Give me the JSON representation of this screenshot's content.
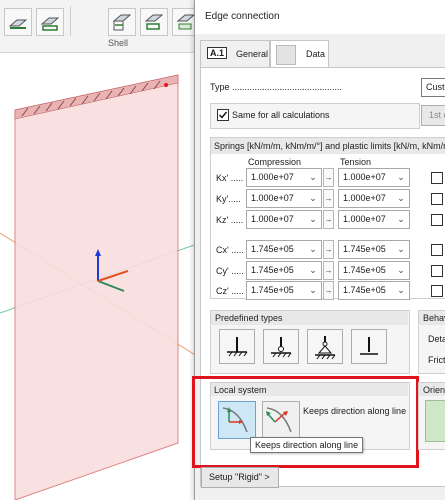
{
  "ribbon": {
    "group_label": "Shell"
  },
  "dialog": {
    "title": "Edge connection",
    "tabs": [
      {
        "icon_text": "A.1",
        "label": "General"
      },
      {
        "label": "Data"
      }
    ],
    "type_label": "Type ............................................",
    "type_value": "Custo",
    "same_for_all_label": "Same for all calculations",
    "same_for_all_checked": true,
    "first_order_button": "1st o",
    "springs_title": "Springs [kN/m/m, kNm/m/°] and plastic limits [kN/m, kNm/m]",
    "compression_header": "Compression",
    "tension_header": "Tension",
    "rows": [
      {
        "label": "Kx' .....",
        "compression": "1.000e+07",
        "tension": "1.000e+07"
      },
      {
        "label": "Ky'.....",
        "compression": "1.000e+07",
        "tension": "1.000e+07"
      },
      {
        "label": "Kz' .....",
        "compression": "1.000e+07",
        "tension": "1.000e+07"
      },
      {
        "label": "Cx' .....",
        "compression": "1.745e+05",
        "tension": "1.745e+05"
      },
      {
        "label": "Cy' .....",
        "compression": "1.745e+05",
        "tension": "1.745e+05"
      },
      {
        "label": "Cz' .....",
        "compression": "1.745e+05",
        "tension": "1.745e+05"
      }
    ],
    "predefined_types_title": "Predefined types",
    "behaviour_title": "Behav",
    "behaviour_items": [
      "Deta",
      "Frict"
    ],
    "local_system_title": "Local system",
    "local_system_text": "Keeps direction along line",
    "tooltip": "Keeps direction along line",
    "orientation_title": "Orien",
    "setup_button": "Setup \"Rigid\" >"
  },
  "colors": {
    "highlight_red": "#e0141c",
    "plate_fill": "#f9dede",
    "selected_button": "#cde7f7"
  }
}
